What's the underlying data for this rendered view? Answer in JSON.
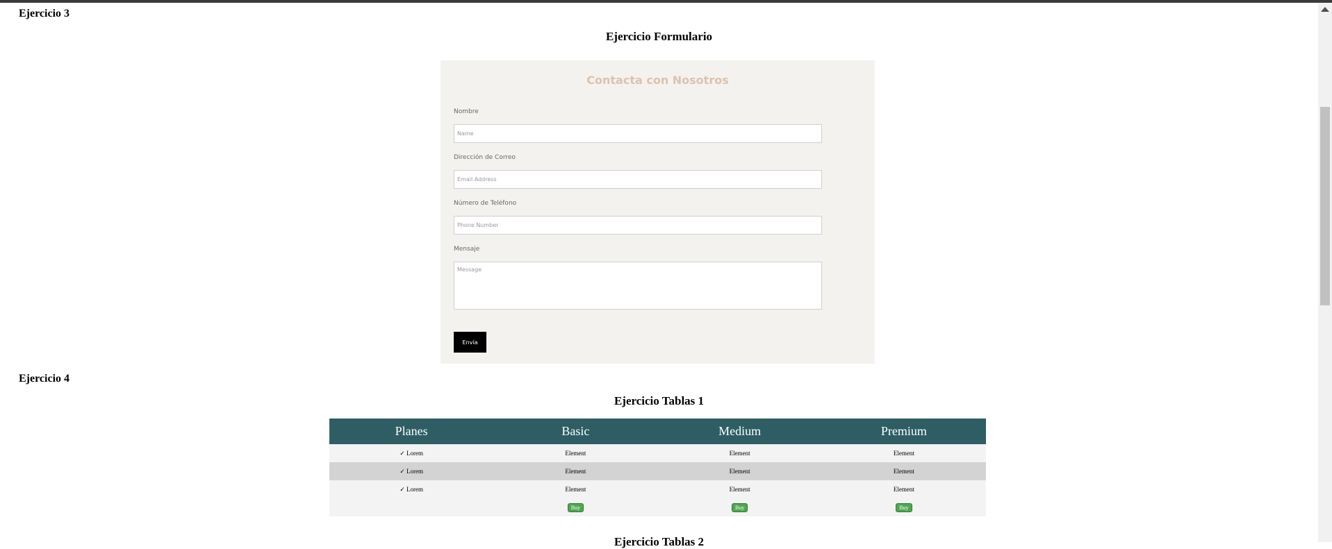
{
  "ex3": {
    "label": "Ejercicio 3",
    "title": "Ejercicio Formulario",
    "form": {
      "heading": "Contacta con Nosotros",
      "name_label": "Nombre",
      "name_placeholder": "Name",
      "email_label": "Dirección de Correo",
      "email_placeholder": "Email Address",
      "phone_label": "Número de Teléfono",
      "phone_placeholder": "Phone Number",
      "message_label": "Mensaje",
      "message_placeholder": "Message",
      "submit_label": "Envía"
    }
  },
  "ex4": {
    "label": "Ejercicio 4",
    "title": "Ejercicio Tablas 1",
    "table": {
      "headers": [
        "Planes",
        "Basic",
        "Medium",
        "Premium"
      ],
      "rows": [
        [
          "✓ Lorem",
          "Element",
          "Element",
          "Element"
        ],
        [
          "✓ Lorem",
          "Element",
          "Element",
          "Element"
        ],
        [
          "✓ Lorem",
          "Element",
          "Element",
          "Element"
        ]
      ],
      "buy_label": "Buy"
    }
  },
  "next_title": "Ejercicio Tablas 2",
  "colors": {
    "header_bg": "#2e5e63",
    "form_bg": "#f3f2ef",
    "form_heading": "#dcc3ac",
    "buy_button": "#4fa74f"
  }
}
